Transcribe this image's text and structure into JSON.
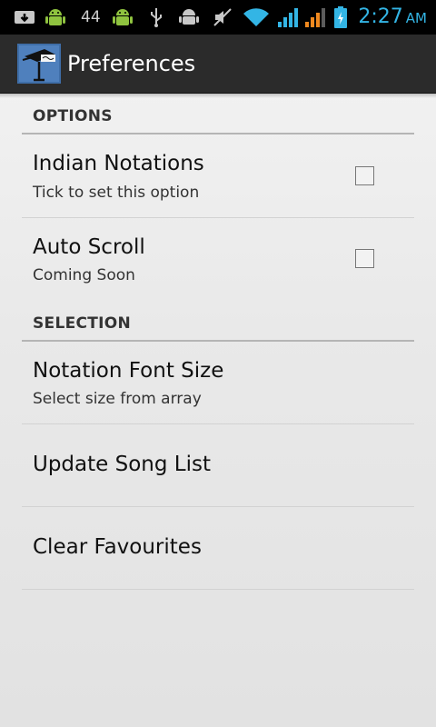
{
  "status_bar": {
    "notification_count": "44",
    "clock_time": "2:27",
    "clock_ampm": "AM",
    "icons": [
      "download-notification-icon",
      "android-icon",
      "android-icon",
      "usb-icon",
      "android-debug-icon",
      "mute-icon",
      "wifi-icon",
      "signal-icon",
      "signal-icon",
      "battery-charging-icon"
    ],
    "accent_color": "#33b5e5"
  },
  "action_bar": {
    "title": "Preferences",
    "icon": "app-logo-icon"
  },
  "preferences": {
    "options": {
      "header": "OPTIONS",
      "indian_notations": {
        "title": "Indian Notations",
        "summary": "Tick to set this option",
        "checked": false
      },
      "auto_scroll": {
        "title": "Auto Scroll",
        "summary": "Coming Soon",
        "checked": false
      }
    },
    "selection": {
      "header": "SELECTION",
      "font_size": {
        "title": "Notation Font Size",
        "summary": "Select size from array"
      },
      "update_list": {
        "title": "Update Song List"
      },
      "clear_favourites": {
        "title": "Clear Favourites"
      }
    }
  }
}
